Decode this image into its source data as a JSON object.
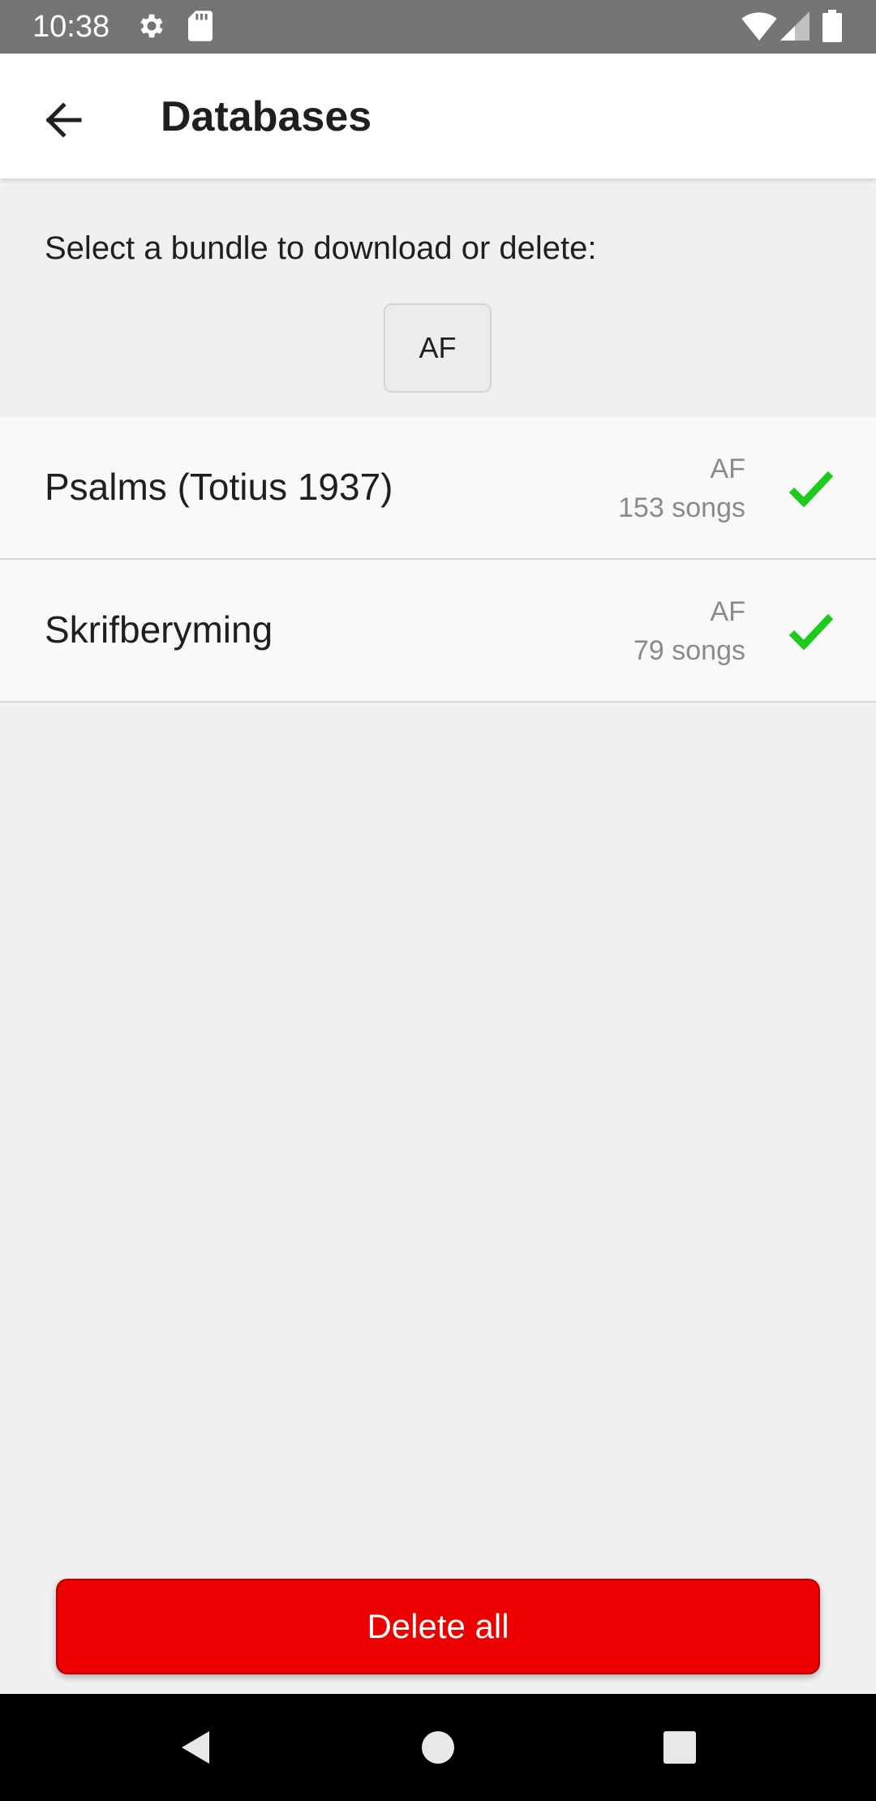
{
  "status_bar": {
    "time": "10:38",
    "icons": [
      "gear-icon",
      "sd-card-icon",
      "wifi-icon",
      "cell-signal-icon",
      "battery-icon"
    ]
  },
  "app_bar": {
    "title": "Databases",
    "back_icon": "arrow-back-icon"
  },
  "content": {
    "prompt": "Select a bundle to download or delete:",
    "language_filter": "AF"
  },
  "bundles": [
    {
      "name": "Psalms (Totius 1937)",
      "language": "AF",
      "count": "153 songs",
      "status_icon": "check-icon"
    },
    {
      "name": "Skrifberyming",
      "language": "AF",
      "count": "79 songs",
      "status_icon": "check-icon"
    }
  ],
  "actions": {
    "delete_all_label": "Delete all"
  },
  "colors": {
    "status_bar": "#757575",
    "danger": "#ec0000",
    "check": "#1ccc1c",
    "secondary_text": "#8a8a8a"
  },
  "nav_bar": {
    "buttons": [
      "back-triangle-icon",
      "home-circle-icon",
      "recents-square-icon"
    ]
  }
}
